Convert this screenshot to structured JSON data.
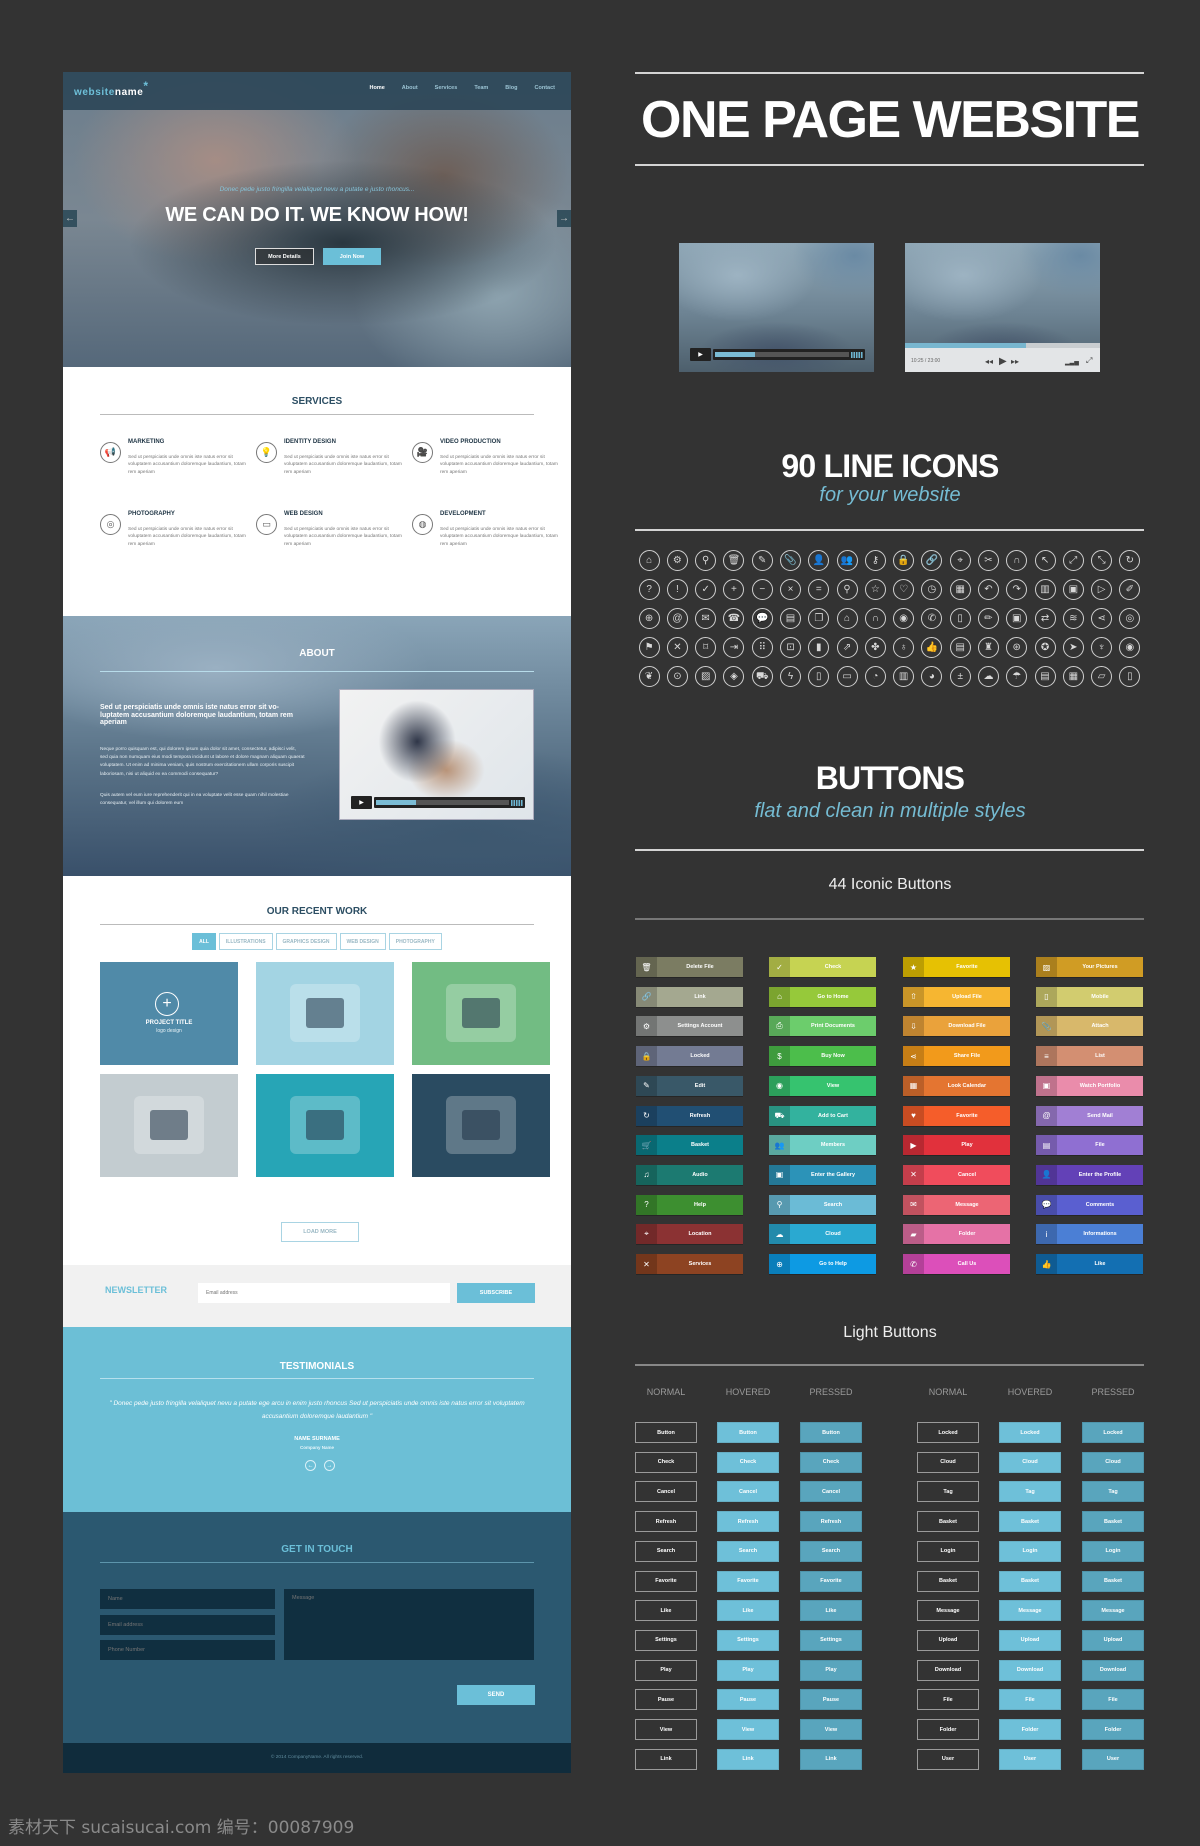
{
  "website": {
    "logo": {
      "part1": "website",
      "part2": "name",
      "mark": "*"
    },
    "nav": [
      "Home",
      "About",
      "Services",
      "Team",
      "Blog",
      "Contact"
    ],
    "nav_active": "Home",
    "hero": {
      "subtitle": "Donec pede justo fringilla velaliquet nevu a putate e justo rhoncus...",
      "title": "WE CAN DO IT. WE KNOW HOW!",
      "btn_more": "More Details",
      "btn_join": "Join Now",
      "prev_icon": "arrow-left-icon",
      "next_icon": "arrow-right-icon"
    },
    "services": {
      "title": "SERVICES",
      "items": [
        {
          "title": "MARKETING",
          "icon": "megaphone-icon",
          "glyph": "📢",
          "text": "Sed ut perspiciatis unde omnis iste natus error sit voluptatem accusantium doloremque laudantium, totam rem aperiam"
        },
        {
          "title": "IDENTITY DESIGN",
          "icon": "lightbulb-icon",
          "glyph": "💡",
          "text": "Sed ut perspiciatis unde omnis iste natus error sit voluptatem accusantium doloremque laudantium, totam rem aperiam"
        },
        {
          "title": "VIDEO PRODUCTION",
          "icon": "video-camera-icon",
          "glyph": "🎥",
          "text": "Sed ut perspiciatis unde omnis iste natus error sit voluptatem accusantium doloremque laudantium, totam rem aperiam"
        },
        {
          "title": "PHOTOGRAPHY",
          "icon": "aperture-icon",
          "glyph": "◎",
          "text": "Sed ut perspiciatis unde omnis iste natus error sit voluptatem accusantium doloremque laudantium, totam rem aperiam"
        },
        {
          "title": "WEB DESIGN",
          "icon": "laptop-icon",
          "glyph": "▭",
          "text": "Sed ut perspiciatis unde omnis iste natus error sit voluptatem accusantium doloremque laudantium, totam rem aperiam"
        },
        {
          "title": "DEVELOPMENT",
          "icon": "palette-icon",
          "glyph": "◍",
          "text": "Sed ut perspiciatis unde omnis iste natus error sit voluptatem accusantium doloremque laudantium, totam rem aperiam"
        }
      ]
    },
    "about": {
      "title": "ABOUT",
      "heading": "Sed ut perspiciatis unde omnis iste natus error sit vo-luptatem accusantium doloremque laudantium, totam rem aperiam",
      "para1": "Neque porro quisquam est, qui dolorem ipsum quia dolor sit amet, consectetur, adipisci velit, sed quia non numquam eius modi tempora incidunt ut labore et dolore magnam aliquam quaerat voluptatem. Ut enim ad minima veniam, quis nostrum exercitationem ullam corporis suscipit laboriosam, nisi ut aliquid ex ea commodi consequatur?",
      "para2": "Quis autem vel eum iure reprehenderit qui in ea voluptate velit esse quam nihil molestiae consequatur, vel illum qui dolorem eum",
      "video_progress": 0.3
    },
    "work": {
      "title": "OUR RECENT WORK",
      "filters": [
        "ALL",
        "ILLUSTRATIONS",
        "GRAPHICS DESIGN",
        "WEB DESIGN",
        "PHOTOGRAPHY"
      ],
      "active_filter": "ALL",
      "project_title": "PROJECT TITLE",
      "project_sub": "logo design",
      "tiles": [
        {
          "name": "project-tile-featured",
          "color": "#508aa8"
        },
        {
          "name": "illustration-businessman",
          "color": "#a3d4e3"
        },
        {
          "name": "illustration-mobile-apps",
          "color": "#72bc83"
        },
        {
          "name": "illustration-responsive-devices",
          "color": "#c3ccd0"
        },
        {
          "name": "illustration-hands-smartphones",
          "color": "#27a5b6"
        },
        {
          "name": "illustration-banking-world",
          "color": "#2a4b61"
        }
      ],
      "load_more": "LOAD MORE"
    },
    "newsletter": {
      "label": "NEWSLETTER",
      "placeholder": "Email address",
      "button": "SUBSCRIBE"
    },
    "testimonials": {
      "title": "TESTIMONIALS",
      "quote": "\" Donec pede justo fringilla velaliquet nevu a putate ege arcu in enim justo rhoncus Sed ut perspiciatis unde omnis iste natus error sit voluptatem accusantium doloremque laudantium \"",
      "name": "NAME SURNAME",
      "company": "Company Name"
    },
    "contact": {
      "title": "GET IN TOUCH",
      "name_ph": "Name",
      "email_ph": "Email address",
      "phone_ph": "Phone Number",
      "message_ph": "Message",
      "send": "SEND"
    },
    "footer": "© 2014 CompanyName. All rights reserved."
  },
  "showcase": {
    "title": "ONE PAGE WEBSITE",
    "player2": {
      "time": "10:25 / 23:00",
      "progress": 0.62
    },
    "player1": {
      "progress": 0.3
    },
    "icons_title": "90 LINE ICONS",
    "icons_sub": "for your website",
    "icons": [
      {
        "n": "home",
        "g": "⌂"
      },
      {
        "n": "settings",
        "g": "⚙"
      },
      {
        "n": "search",
        "g": "⚲"
      },
      {
        "n": "trash",
        "g": "🗑"
      },
      {
        "n": "edit",
        "g": "✎"
      },
      {
        "n": "paperclip",
        "g": "📎"
      },
      {
        "n": "user",
        "g": "👤"
      },
      {
        "n": "users",
        "g": "👥"
      },
      {
        "n": "key",
        "g": "⚷"
      },
      {
        "n": "lock",
        "g": "🔒"
      },
      {
        "n": "link",
        "g": "🔗"
      },
      {
        "n": "location-pin",
        "g": "⌖"
      },
      {
        "n": "scissors",
        "g": "✂"
      },
      {
        "n": "headset",
        "g": "∩"
      },
      {
        "n": "cursor",
        "g": "↖"
      },
      {
        "n": "expand",
        "g": "⤢"
      },
      {
        "n": "collapse",
        "g": "⤡"
      },
      {
        "n": "refresh",
        "g": "↻"
      },
      {
        "n": "question",
        "g": "?"
      },
      {
        "n": "exclamation",
        "g": "!"
      },
      {
        "n": "check",
        "g": "✓"
      },
      {
        "n": "plus",
        "g": "+"
      },
      {
        "n": "minus",
        "g": "−"
      },
      {
        "n": "close",
        "g": "×"
      },
      {
        "n": "equals",
        "g": "="
      },
      {
        "n": "zoom",
        "g": "⚲"
      },
      {
        "n": "star",
        "g": "☆"
      },
      {
        "n": "heart",
        "g": "♡"
      },
      {
        "n": "clock",
        "g": "◷"
      },
      {
        "n": "calendar",
        "g": "▦"
      },
      {
        "n": "reply",
        "g": "↶"
      },
      {
        "n": "forward",
        "g": "↷"
      },
      {
        "n": "building",
        "g": "▥"
      },
      {
        "n": "video-camera",
        "g": "▣"
      },
      {
        "n": "play-video",
        "g": "▷"
      },
      {
        "n": "brush",
        "g": "✐"
      },
      {
        "n": "globe",
        "g": "⊕"
      },
      {
        "n": "at",
        "g": "@"
      },
      {
        "n": "mail",
        "g": "✉"
      },
      {
        "n": "telephone",
        "g": "☎"
      },
      {
        "n": "chat",
        "g": "💬"
      },
      {
        "n": "comment",
        "g": "▤"
      },
      {
        "n": "comments",
        "g": "❐"
      },
      {
        "n": "shop",
        "g": "⌂"
      },
      {
        "n": "support",
        "g": "∩"
      },
      {
        "n": "support-24",
        "g": "◉"
      },
      {
        "n": "phone",
        "g": "✆"
      },
      {
        "n": "mobile",
        "g": "▯"
      },
      {
        "n": "pencil",
        "g": "✏"
      },
      {
        "n": "contacts",
        "g": "▣"
      },
      {
        "n": "toggles",
        "g": "⇄"
      },
      {
        "n": "wifi",
        "g": "≋"
      },
      {
        "n": "share",
        "g": "⋖"
      },
      {
        "n": "dribbble",
        "g": "◎"
      },
      {
        "n": "flag",
        "g": "⚑"
      },
      {
        "n": "tools",
        "g": "✕"
      },
      {
        "n": "tag",
        "g": "⌑"
      },
      {
        "n": "logout",
        "g": "⇥"
      },
      {
        "n": "grid",
        "g": "⠿"
      },
      {
        "n": "briefcase",
        "g": "⊡"
      },
      {
        "n": "chart-bars",
        "g": "▮"
      },
      {
        "n": "rocket",
        "g": "⇗"
      },
      {
        "n": "puzzle",
        "g": "✤"
      },
      {
        "n": "bulb",
        "g": "♁"
      },
      {
        "n": "thumbs-up",
        "g": "👍"
      },
      {
        "n": "browser",
        "g": "▤"
      },
      {
        "n": "trophy",
        "g": "♜"
      },
      {
        "n": "coins",
        "g": "⊛"
      },
      {
        "n": "award",
        "g": "✪"
      },
      {
        "n": "send",
        "g": "➤"
      },
      {
        "n": "microphone",
        "g": "♆"
      },
      {
        "n": "eye",
        "g": "◉"
      },
      {
        "n": "leaf",
        "g": "❦"
      },
      {
        "n": "camera",
        "g": "⊙"
      },
      {
        "n": "picture",
        "g": "▨"
      },
      {
        "n": "box",
        "g": "◈"
      },
      {
        "n": "cart",
        "g": "⛟"
      },
      {
        "n": "lightning",
        "g": "ϟ"
      },
      {
        "n": "tablet",
        "g": "▯"
      },
      {
        "n": "monitor",
        "g": "▭"
      },
      {
        "n": "growth-chart",
        "g": "◔"
      },
      {
        "n": "bar-chart",
        "g": "▥"
      },
      {
        "n": "pie-chart",
        "g": "◕"
      },
      {
        "n": "calculator",
        "g": "±"
      },
      {
        "n": "weather",
        "g": "☁"
      },
      {
        "n": "umbrella",
        "g": "☂"
      },
      {
        "n": "document",
        "g": "▤"
      },
      {
        "n": "clipboard",
        "g": "▦"
      },
      {
        "n": "folder",
        "g": "▱"
      },
      {
        "n": "book",
        "g": "▯"
      }
    ],
    "buttons_title": "BUTTONS",
    "buttons_sub": "flat and clean in multiple styles",
    "iconic_title": "44 Iconic Buttons",
    "iconic_buttons": [
      [
        {
          "label": "Delete File",
          "icon": "trash-icon",
          "g": "🗑",
          "color": "#7b7c62"
        },
        {
          "label": "Link",
          "icon": "link-icon",
          "g": "🔗",
          "color": "#a4a890"
        },
        {
          "label": "Settings Account",
          "icon": "user-settings-icon",
          "g": "⚙",
          "color": "#8d8f8e"
        },
        {
          "label": "Locked",
          "icon": "lock-icon",
          "g": "🔒",
          "color": "#737b93"
        },
        {
          "label": "Edit",
          "icon": "pencil-icon",
          "g": "✎",
          "color": "#395868"
        },
        {
          "label": "Refresh",
          "icon": "refresh-icon",
          "g": "↻",
          "color": "#214f73"
        },
        {
          "label": "Basket",
          "icon": "basket-icon",
          "g": "🛒",
          "color": "#0b7f8a"
        },
        {
          "label": "Audio",
          "icon": "music-icon",
          "g": "♫",
          "color": "#1c7a71"
        },
        {
          "label": "Help",
          "icon": "help-icon",
          "g": "?",
          "color": "#3d8f30"
        },
        {
          "label": "Location",
          "icon": "location-icon",
          "g": "⌖",
          "color": "#8b3233"
        },
        {
          "label": "Services",
          "icon": "tools-icon",
          "g": "✕",
          "color": "#8d4322"
        }
      ],
      [
        {
          "label": "Check",
          "icon": "check-icon",
          "g": "✓",
          "color": "#c6d352"
        },
        {
          "label": "Go to Home",
          "icon": "home-icon",
          "g": "⌂",
          "color": "#96c93a"
        },
        {
          "label": "Print Documents",
          "icon": "printer-icon",
          "g": "⎙",
          "color": "#6ccd6c"
        },
        {
          "label": "Buy Now",
          "icon": "dollar-icon",
          "g": "$",
          "color": "#4cbe4b"
        },
        {
          "label": "View",
          "icon": "eye-icon",
          "g": "◉",
          "color": "#36c36f"
        },
        {
          "label": "Add to Cart",
          "icon": "cart-icon",
          "g": "⛟",
          "color": "#33b29e"
        },
        {
          "label": "Members",
          "icon": "members-icon",
          "g": "👥",
          "color": "#6ecec3"
        },
        {
          "label": "Enter the Gallery",
          "icon": "camera-icon",
          "g": "▣",
          "color": "#2c93b8"
        },
        {
          "label": "Search",
          "icon": "search-icon",
          "g": "⚲",
          "color": "#6bbbd6"
        },
        {
          "label": "Cloud",
          "icon": "cloud-icon",
          "g": "☁",
          "color": "#2aa9d1"
        },
        {
          "label": "Go to Help",
          "icon": "lifebuoy-icon",
          "g": "⊕",
          "color": "#0d9ae3"
        }
      ],
      [
        {
          "label": "Favorite",
          "icon": "star-icon",
          "g": "★",
          "color": "#e6c103"
        },
        {
          "label": "Upload File",
          "icon": "upload-icon",
          "g": "⇧",
          "color": "#f6b631"
        },
        {
          "label": "Download File",
          "icon": "download-icon",
          "g": "⇩",
          "color": "#eaa23b"
        },
        {
          "label": "Share File",
          "icon": "share-icon",
          "g": "⋖",
          "color": "#f29a1b"
        },
        {
          "label": "Look Calendar",
          "icon": "calendar-icon",
          "g": "▦",
          "color": "#e47531"
        },
        {
          "label": "Favorite",
          "icon": "heart-icon",
          "g": "♥",
          "color": "#f55d2a"
        },
        {
          "label": "Play",
          "icon": "play-icon",
          "g": "▶",
          "color": "#e1313c"
        },
        {
          "label": "Cancel",
          "icon": "close-icon",
          "g": "✕",
          "color": "#f04c5c"
        },
        {
          "label": "Message",
          "icon": "mail-icon",
          "g": "✉",
          "color": "#ec6574"
        },
        {
          "label": "Folder",
          "icon": "folder-icon",
          "g": "▰",
          "color": "#e572a6"
        },
        {
          "label": "Call Us",
          "icon": "phone-icon",
          "g": "✆",
          "color": "#dc4fba"
        }
      ],
      [
        {
          "label": "Your Pictures",
          "icon": "picture-icon",
          "g": "▨",
          "color": "#d09c24"
        },
        {
          "label": "Mobile",
          "icon": "mobile-icon",
          "g": "▯",
          "color": "#d2cc6f"
        },
        {
          "label": "Attach",
          "icon": "paperclip-icon",
          "g": "📎",
          "color": "#d8b86b"
        },
        {
          "label": "List",
          "icon": "list-icon",
          "g": "≡",
          "color": "#d38f72"
        },
        {
          "label": "Watch Portfolio",
          "icon": "briefcase-icon",
          "g": "▣",
          "color": "#ea8cab"
        },
        {
          "label": "Send Mail",
          "icon": "at-icon",
          "g": "@",
          "color": "#a17fd4"
        },
        {
          "label": "File",
          "icon": "file-icon",
          "g": "▤",
          "color": "#8f6fd2"
        },
        {
          "label": "Enter the Profile",
          "icon": "profile-icon",
          "g": "👤",
          "color": "#6341b7"
        },
        {
          "label": "Comments",
          "icon": "comments-icon",
          "g": "💬",
          "color": "#5a5fd0"
        },
        {
          "label": "Informations",
          "icon": "info-icon",
          "g": "i",
          "color": "#4b7fd5"
        },
        {
          "label": "Like",
          "icon": "thumbs-up-icon",
          "g": "👍",
          "color": "#136fb2"
        }
      ]
    ],
    "light_title": "Light Buttons",
    "light_states": [
      "NORMAL",
      "HOVERED",
      "PRESSED"
    ],
    "light_left": [
      "Button",
      "Check",
      "Cancel",
      "Refresh",
      "Search",
      "Favorite",
      "Like",
      "Settings",
      "Play",
      "Pause",
      "View",
      "Link"
    ],
    "light_right": [
      "Locked",
      "Cloud",
      "Tag",
      "Basket",
      "Login",
      "Basket",
      "Message",
      "Upload",
      "Download",
      "File",
      "Folder",
      "User"
    ],
    "watermark": "素材天下 sucaisucai.com  编号：00087909"
  }
}
